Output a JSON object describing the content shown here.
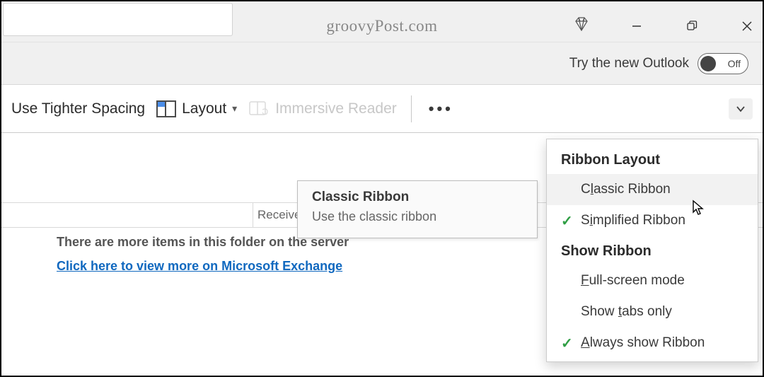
{
  "titlebar": {
    "title": "groovyPost.com"
  },
  "tryNew": {
    "label": "Try the new Outlook",
    "toggleState": "Off"
  },
  "ribbon": {
    "tighterSpacing": "Use Tighter Spacing",
    "layout": "Layout",
    "immersiveReader": "Immersive Reader"
  },
  "content": {
    "receiveHeader": "Receive",
    "moreItems": "There are more items in this folder on the server",
    "clickLink": "Click here to view more on Microsoft Exchange"
  },
  "tooltip": {
    "title": "Classic Ribbon",
    "description": "Use the classic ribbon"
  },
  "menu": {
    "section1": "Ribbon Layout",
    "items1": [
      {
        "label": "Classic Ribbon",
        "accel": "l",
        "prefix": "C",
        "suffix": "assic Ribbon",
        "checked": false,
        "hover": true
      },
      {
        "label": "Simplified Ribbon",
        "accel": "i",
        "prefix": "S",
        "suffix": "mplified Ribbon",
        "checked": true,
        "hover": false
      }
    ],
    "section2": "Show Ribbon",
    "items2": [
      {
        "label": "Full-screen mode",
        "accel": "F",
        "prefix": "",
        "suffix": "ull-screen mode",
        "checked": false
      },
      {
        "label": "Show tabs only",
        "accel": "t",
        "prefix": "Show ",
        "suffix": "abs only",
        "checked": false
      },
      {
        "label": "Always show Ribbon",
        "accel": "A",
        "prefix": "",
        "suffix": "lways show Ribbon",
        "checked": true
      }
    ]
  }
}
